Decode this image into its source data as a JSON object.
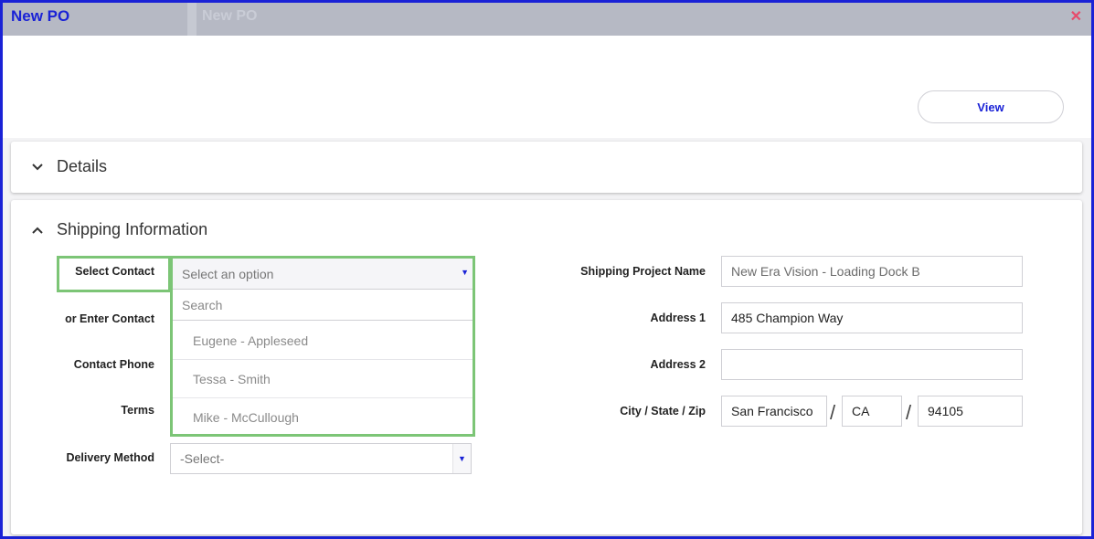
{
  "window": {
    "title": "New PO",
    "ghost_title": "New PO",
    "ghost_tab": "",
    "close_icon": "close-icon"
  },
  "toolbar": {
    "view_label": "View"
  },
  "sections": {
    "details": {
      "title": "Details",
      "expanded": false
    },
    "shipping": {
      "title": "Shipping Information",
      "expanded": true
    }
  },
  "contact": {
    "select_label": "Select Contact",
    "select_placeholder": "Select an option",
    "search_placeholder": "Search",
    "options": [
      "Eugene - Appleseed",
      "Tessa - Smith",
      "Mike - McCullough"
    ],
    "enter_label": "or Enter Contact",
    "phone_label": "Contact Phone",
    "terms_label": "Terms",
    "delivery_label": "Delivery Method",
    "delivery_value": "-Select-"
  },
  "shipping": {
    "project_name_label": "Shipping Project Name",
    "project_name_value": "New Era Vision - Loading Dock B",
    "address1_label": "Address 1",
    "address1_value": "485 Champion Way",
    "address2_label": "Address 2",
    "address2_value": "",
    "city_state_zip_label": "City / State / Zip",
    "city": "San Francisco",
    "state": "CA",
    "zip": "94105",
    "separator": "/"
  },
  "colors": {
    "accent": "#1a22d6",
    "highlight": "#7cc576",
    "close": "#e64b6b"
  }
}
